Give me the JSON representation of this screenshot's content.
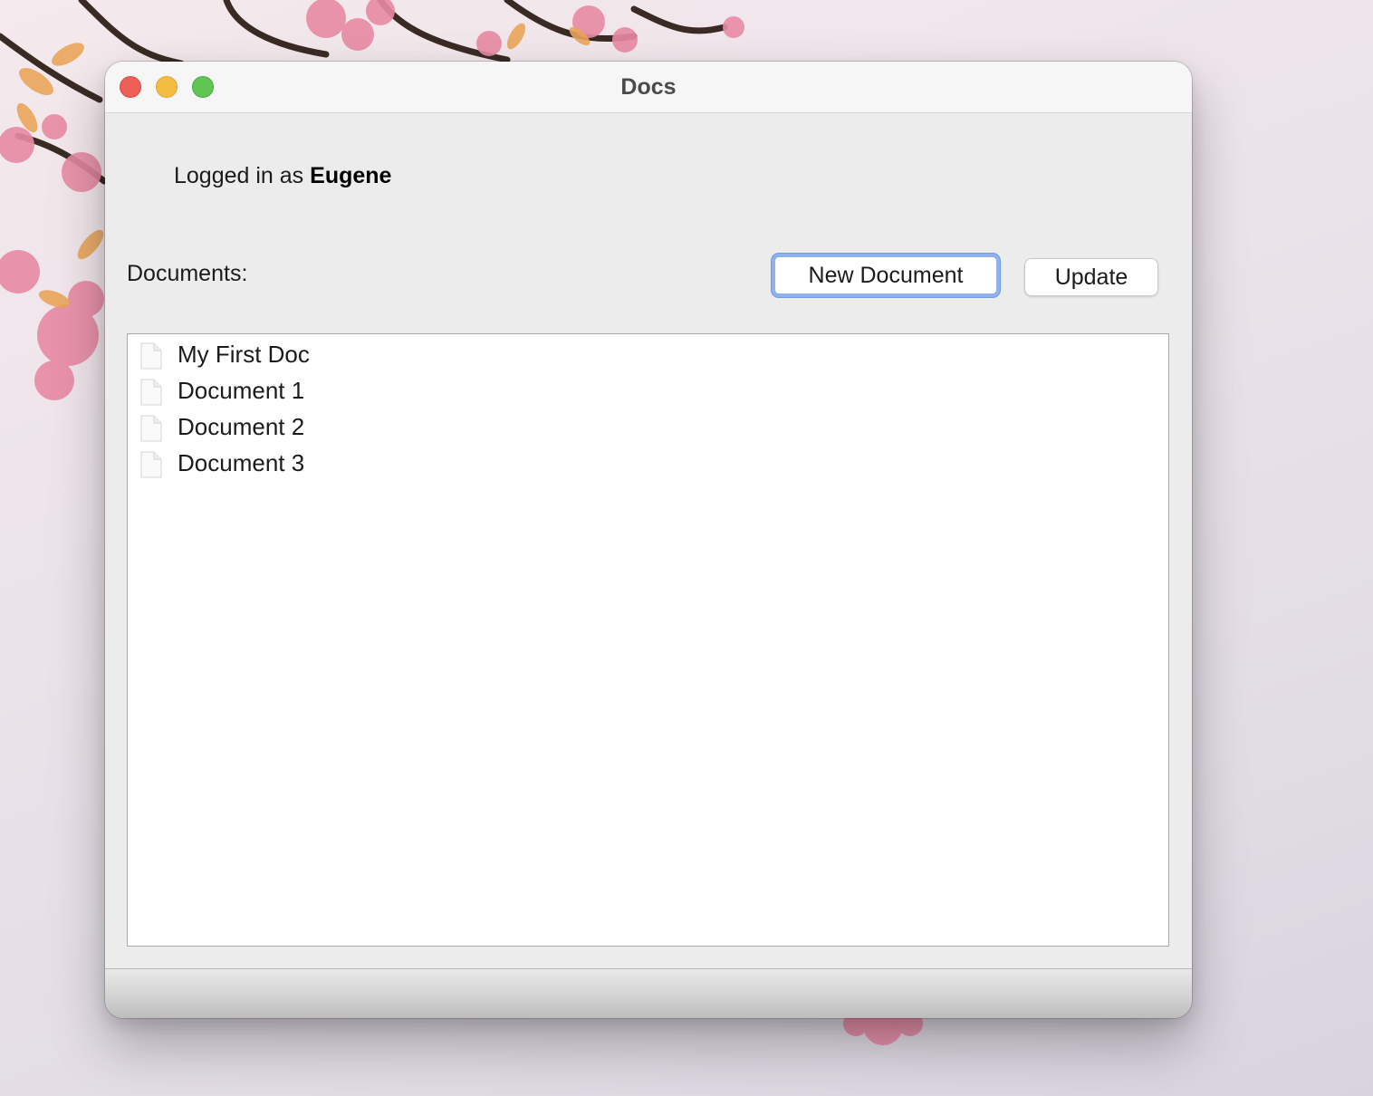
{
  "window": {
    "title": "Docs"
  },
  "session": {
    "prefix": "Logged in as",
    "username": "Eugene"
  },
  "documents_section": {
    "label": "Documents:",
    "new_document_label": "New Document",
    "update_label": "Update"
  },
  "documents": [
    {
      "name": "My First Doc",
      "icon": "document-icon"
    },
    {
      "name": "Document 1",
      "icon": "document-icon"
    },
    {
      "name": "Document 2",
      "icon": "document-icon"
    },
    {
      "name": "Document 3",
      "icon": "document-icon"
    }
  ],
  "colors": {
    "focus_ring": "#8fb2ef",
    "close": "#ee5f57",
    "minimize": "#f5bd3f",
    "zoom": "#5fc553"
  }
}
